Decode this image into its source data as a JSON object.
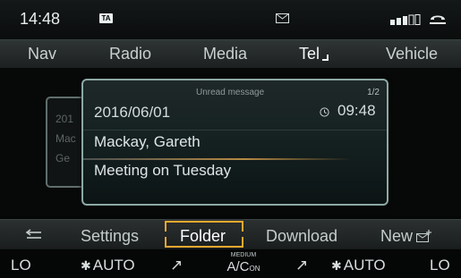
{
  "status": {
    "time": "14:48",
    "ta_badge": "TA",
    "mail_icon": "envelope-icon",
    "signal_icon": "signal-strength-icon",
    "phone_icon": "phone-handset-icon"
  },
  "top_nav": [
    {
      "label": "Nav"
    },
    {
      "label": "Radio"
    },
    {
      "label": "Media"
    },
    {
      "label": "Tel"
    },
    {
      "label": "Vehicle"
    }
  ],
  "message": {
    "header": "Unread message",
    "page": "1/2",
    "date": "2016/06/01",
    "time": "09:48",
    "sender": "Mackay, Gareth",
    "subject": "Meeting on Tuesday"
  },
  "background_card": {
    "line1": "201",
    "line2": "Mac",
    "line3": "Ge"
  },
  "bottom_bar": {
    "back_icon": "back-arrow-icon",
    "settings": "Settings",
    "folder": "Folder",
    "download": "Download",
    "new": "New",
    "new_icon": "new-envelope-icon"
  },
  "climate": {
    "left_temp": "LO",
    "left_fan": "AUTO",
    "ac_small": "MEDIUM",
    "ac_label": "A/C",
    "ac_sub": "ON",
    "right_fan": "AUTO",
    "right_temp": "LO"
  },
  "colors": {
    "accent_orange": "#f0a830",
    "card_border": "#8ca9a4",
    "text": "#cfd6d6"
  }
}
